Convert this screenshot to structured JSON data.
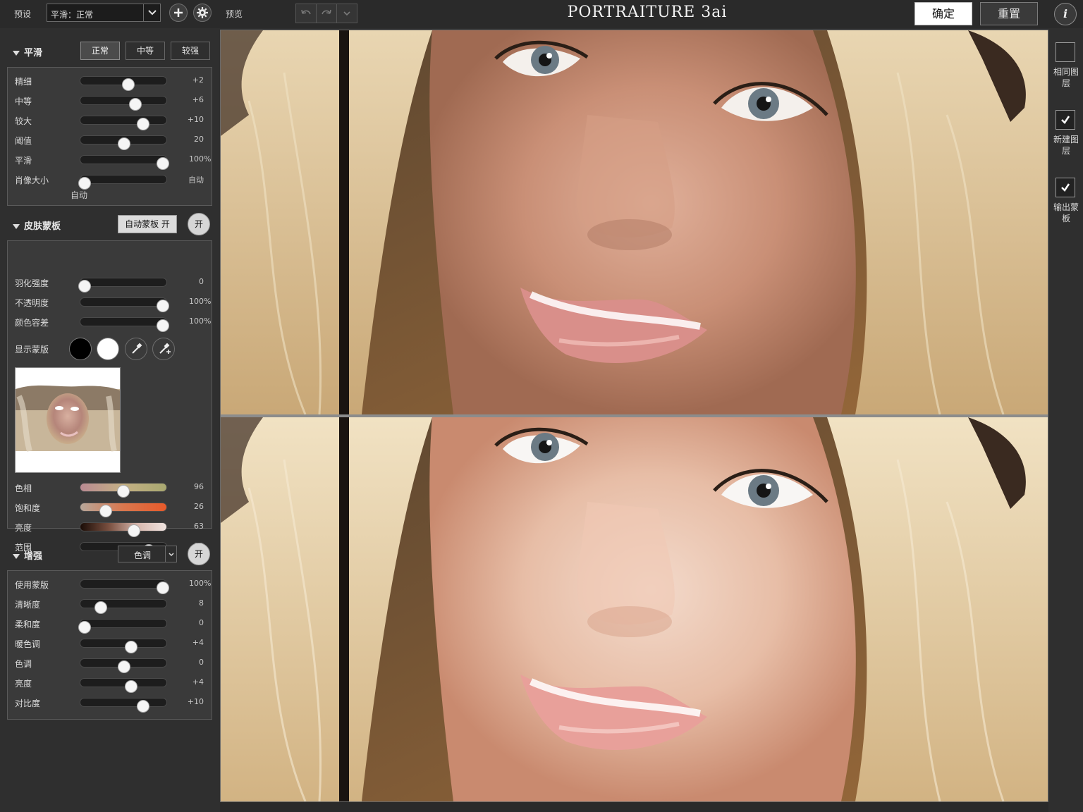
{
  "topbar": {
    "preset_label": "预设",
    "preset_value": "平滑：正常",
    "preview_label": "预览",
    "app_title": "PORTRAITURE 3ai",
    "ok_label": "确定",
    "reset_label": "重置",
    "info_label": "i"
  },
  "smoothing": {
    "title": "平滑",
    "modes": [
      "正常",
      "中等",
      "较强"
    ],
    "active_mode": "正常",
    "sliders": [
      {
        "label": "精细",
        "value": "+2",
        "unit": "",
        "pos": 0.55
      },
      {
        "label": "中等",
        "value": "+6",
        "unit": "",
        "pos": 0.63
      },
      {
        "label": "较大",
        "value": "+10",
        "unit": "",
        "pos": 0.72
      },
      {
        "label": "阈值",
        "value": "20",
        "unit": "",
        "pos": 0.5
      },
      {
        "label": "平滑",
        "value": "100",
        "unit": "%",
        "pos": 0.94
      },
      {
        "label": "肖像大小",
        "value": "自动",
        "unit": "",
        "pos": 0.05
      }
    ],
    "portrait_size_sub": "自动"
  },
  "skin_mask": {
    "title": "皮肤蒙板",
    "auto_mask_label": "自动蒙板 开",
    "on_label": "开",
    "sliders": [
      {
        "label": "羽化强度",
        "value": "0",
        "unit": "",
        "pos": 0.05
      },
      {
        "label": "不透明度",
        "value": "100",
        "unit": "%",
        "pos": 0.94
      },
      {
        "label": "颜色容差",
        "value": "100",
        "unit": "%",
        "pos": 0.94
      }
    ],
    "show_mask_label": "显示蒙版",
    "color_sliders": [
      {
        "label": "色相",
        "value": "96",
        "unit": "",
        "pos": 0.49
      },
      {
        "label": "饱和度",
        "value": "26",
        "unit": "",
        "pos": 0.29
      },
      {
        "label": "亮度",
        "value": "63",
        "unit": "",
        "pos": 0.61
      },
      {
        "label": "范围",
        "value": "82",
        "unit": "",
        "pos": 0.78
      }
    ]
  },
  "enhance": {
    "title": "增强",
    "tone_label": "色调",
    "on_label": "开",
    "sliders": [
      {
        "label": "使用蒙版",
        "value": "100",
        "unit": "%",
        "pos": 0.94
      },
      {
        "label": "清晰度",
        "value": "8",
        "unit": "",
        "pos": 0.23
      },
      {
        "label": "柔和度",
        "value": "0",
        "unit": "",
        "pos": 0.05
      },
      {
        "label": "暖色调",
        "value": "+4",
        "unit": "",
        "pos": 0.58
      },
      {
        "label": "色调",
        "value": "0",
        "unit": "",
        "pos": 0.5
      },
      {
        "label": "亮度",
        "value": "+4",
        "unit": "",
        "pos": 0.58
      },
      {
        "label": "对比度",
        "value": "+10",
        "unit": "",
        "pos": 0.72
      }
    ]
  },
  "output": {
    "options": [
      {
        "label": "相同图层",
        "checked": false
      },
      {
        "label": "新建图层",
        "checked": true
      },
      {
        "label": "输出蒙板",
        "checked": true
      }
    ]
  },
  "colors": {
    "accent": "#ffffff",
    "panel_bg": "#2f2f2f",
    "section_bg": "#3a3a3a"
  }
}
